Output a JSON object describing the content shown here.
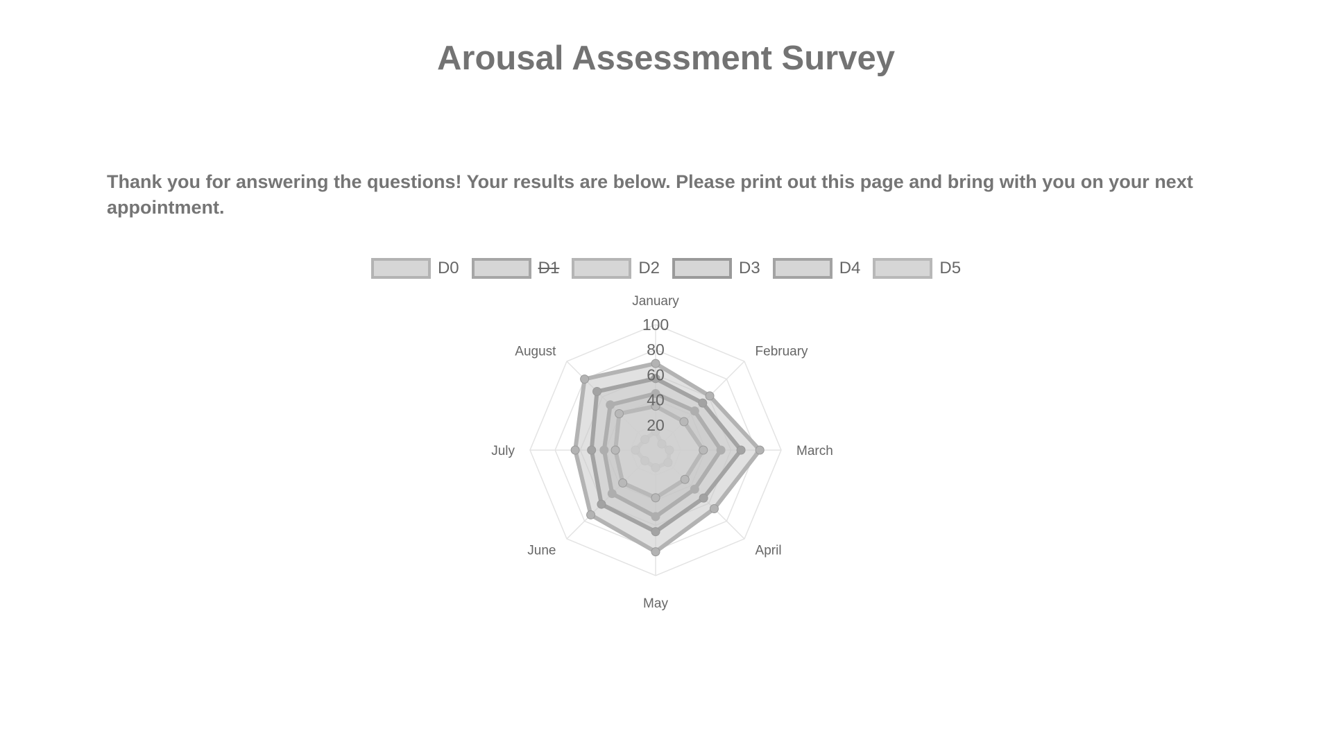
{
  "title": "Arousal Assessment Survey",
  "intro": "Thank you for answering the questions! Your results are below. Please print out this page and bring with you on your next appointment.",
  "chart_data": {
    "type": "radar",
    "categories": [
      "January",
      "February",
      "March",
      "April",
      "May",
      "June",
      "July",
      "August"
    ],
    "rlim": [
      0,
      100
    ],
    "ticks": [
      "20",
      "40",
      "60",
      "80",
      "100"
    ],
    "grid": true,
    "legend": "top",
    "series": [
      {
        "name": "D0",
        "hidden": false,
        "values": [
          69,
          61,
          83,
          66,
          81,
          73,
          64,
          80
        ],
        "border": "#b3b3b3",
        "fill": "rgba(200,200,200,0.55)"
      },
      {
        "name": "D1",
        "hidden": true,
        "values": null,
        "border": "#a6a6a6",
        "fill": "rgba(200,200,200,0.55)"
      },
      {
        "name": "D2",
        "hidden": false,
        "values": [
          15,
          7,
          11,
          14,
          14,
          12,
          16,
          12
        ],
        "border": "#b5b5b5",
        "fill": "rgba(210,210,210,0.55)"
      },
      {
        "name": "D3",
        "hidden": false,
        "values": [
          45,
          44,
          52,
          44,
          53,
          49,
          41,
          51
        ],
        "border": "#9a9a9a",
        "fill": "rgba(195,195,195,0.45)"
      },
      {
        "name": "D4",
        "hidden": false,
        "values": [
          57,
          53,
          68,
          54,
          65,
          61,
          51,
          66
        ],
        "border": "#a3a3a3",
        "fill": "rgba(200,200,200,0.45)"
      },
      {
        "name": "D5",
        "hidden": false,
        "values": [
          35,
          32,
          38,
          33,
          38,
          37,
          32,
          41
        ],
        "border": "#b8b8b8",
        "fill": "rgba(215,215,215,0.45)"
      }
    ]
  }
}
